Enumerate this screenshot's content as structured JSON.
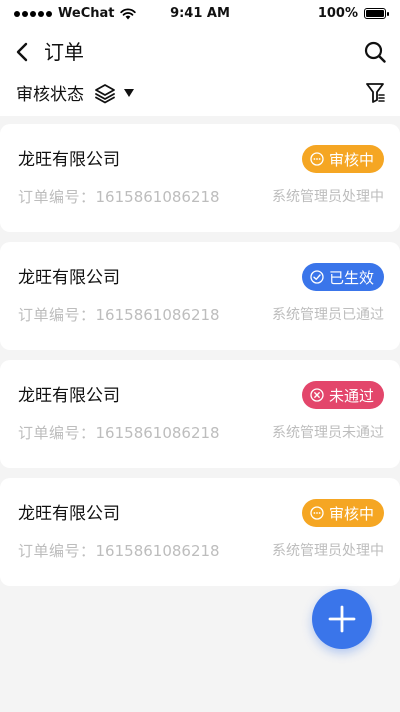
{
  "status_bar": {
    "carrier": "WeChat",
    "time": "9:41 AM",
    "battery": "100%"
  },
  "header": {
    "title": "订单",
    "filter_label": "审核状态"
  },
  "icons": {
    "back": "chevron-left-icon",
    "search": "search-icon",
    "layers": "layers-icon",
    "caret": "caret-down-icon",
    "filter": "filter-icon",
    "add": "plus-icon"
  },
  "colors": {
    "pending": "#f5a623",
    "effective": "#3a75ea",
    "rejected": "#e3466b",
    "fab": "#3a75ea"
  },
  "orders": [
    {
      "company": "龙旺有限公司",
      "order_label": "订单编号：",
      "order_no": "1615861086218",
      "handler": "系统管理员处理中",
      "status": "审核中",
      "status_type": "pending"
    },
    {
      "company": "龙旺有限公司",
      "order_label": "订单编号：",
      "order_no": "1615861086218",
      "handler": "系统管理员已通过",
      "status": "已生效",
      "status_type": "effective"
    },
    {
      "company": "龙旺有限公司",
      "order_label": "订单编号：",
      "order_no": "1615861086218",
      "handler": "系统管理员未通过",
      "status": "未通过",
      "status_type": "rejected"
    },
    {
      "company": "龙旺有限公司",
      "order_label": "订单编号：",
      "order_no": "1615861086218",
      "handler": "系统管理员处理中",
      "status": "审核中",
      "status_type": "pending"
    }
  ]
}
